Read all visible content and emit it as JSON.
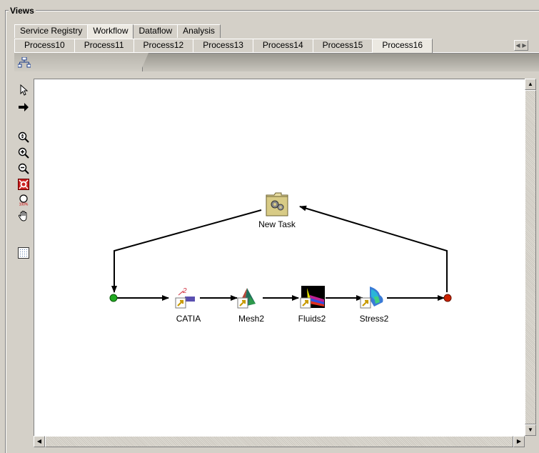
{
  "views": {
    "title": "Views",
    "top_tabs": [
      {
        "label": "Service Registry",
        "active": false
      },
      {
        "label": "Workflow",
        "active": true
      },
      {
        "label": "Dataflow",
        "active": false
      },
      {
        "label": "Analysis",
        "active": false
      }
    ],
    "process_tabs": [
      {
        "label": "Process10",
        "active": false
      },
      {
        "label": "Process11",
        "active": false
      },
      {
        "label": "Process12",
        "active": false
      },
      {
        "label": "Process13",
        "active": false
      },
      {
        "label": "Process14",
        "active": false
      },
      {
        "label": "Process15",
        "active": false
      },
      {
        "label": "Process16",
        "active": true
      }
    ]
  },
  "toolbar": {
    "tools": [
      "select-arrow-icon",
      "connect-arrow-icon",
      "zoom-fit-icon",
      "zoom-in-icon",
      "zoom-out-icon",
      "zoom-reset-icon",
      "zoom-100-icon",
      "pan-hand-icon",
      "grid-icon"
    ]
  },
  "workflow": {
    "task": {
      "label": "New Task"
    },
    "steps": [
      {
        "label": "CATIA"
      },
      {
        "label": "Mesh2"
      },
      {
        "label": "Fluids2"
      },
      {
        "label": "Stress2"
      }
    ],
    "start_color": "#22aa22",
    "end_color": "#cc2200"
  }
}
